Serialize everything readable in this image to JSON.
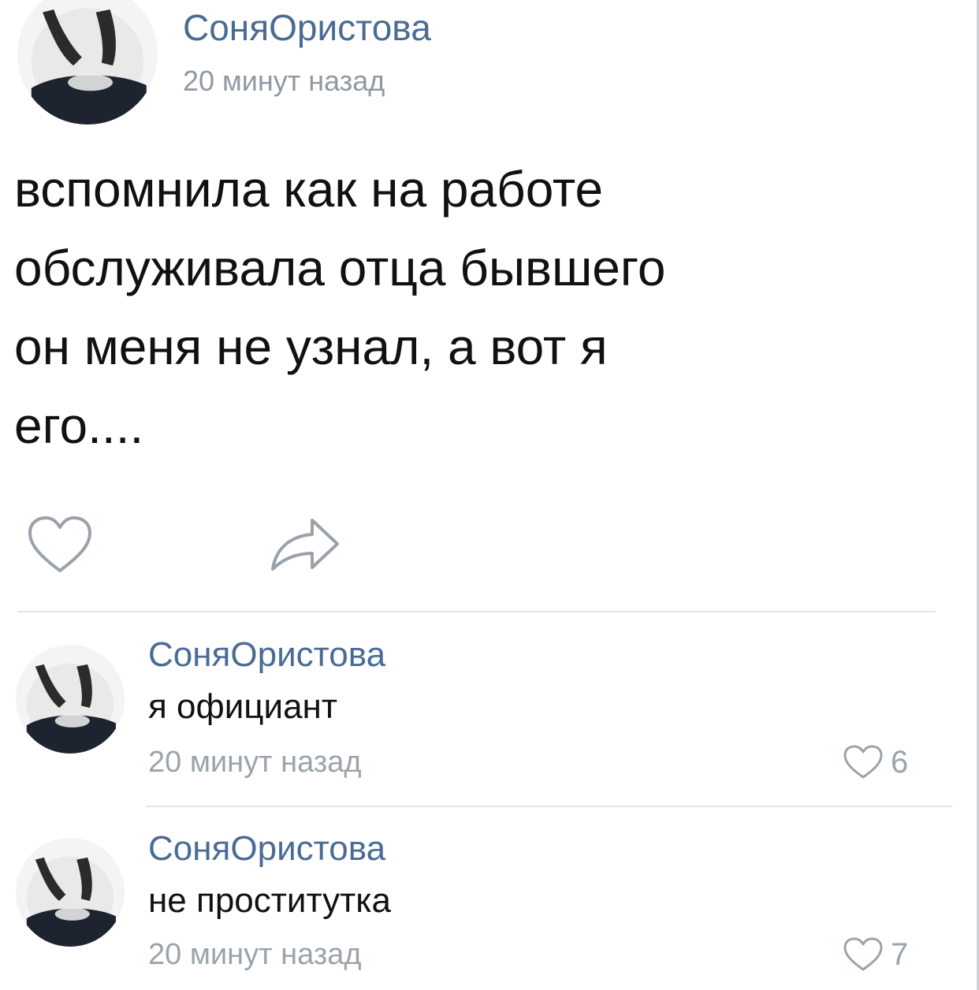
{
  "post": {
    "author": "СоняОристова",
    "time": "20 минут назад",
    "text_lines": [
      "вспомнила как на работе",
      "обслуживала отца бывшего",
      "он меня не узнал, а вот я",
      "его...."
    ],
    "actions": {
      "like_icon": "heart-outline-icon",
      "share_icon": "share-arrow-icon"
    }
  },
  "comments": [
    {
      "author": "СоняОристова",
      "text": "я официант",
      "time": "20 минут назад",
      "likes": "6"
    },
    {
      "author": "СоняОристова",
      "text": "не проститутка",
      "time": "20 минут назад",
      "likes": "7"
    }
  ],
  "colors": {
    "author_link": "#4a6b94",
    "timestamp": "#9099a3",
    "text": "#111111",
    "divider": "#e3e5e8"
  }
}
